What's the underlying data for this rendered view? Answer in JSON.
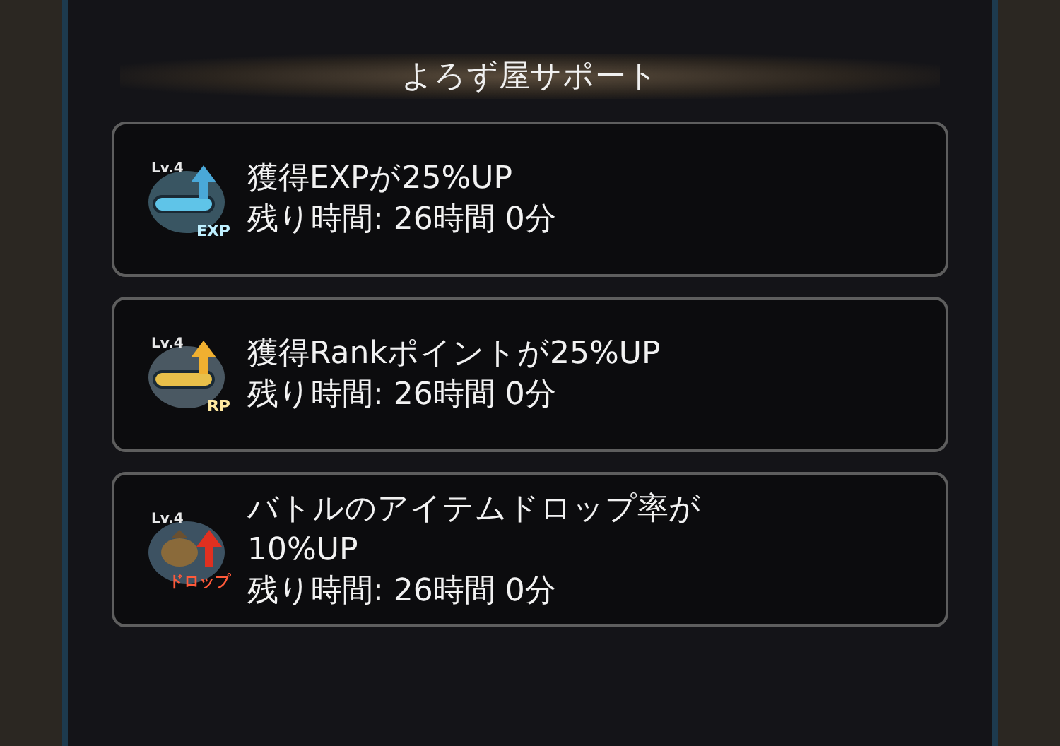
{
  "title": "よろず屋サポート",
  "supports": [
    {
      "kind": "exp",
      "level_label": "Lv.4",
      "badge": "EXP",
      "lines": [
        "獲得EXPが25%UP",
        "残り時間: 26時間 0分"
      ]
    },
    {
      "kind": "rp",
      "level_label": "Lv.4",
      "badge": "RP",
      "lines": [
        "獲得Rankポイントが25%UP",
        "残り時間: 26時間 0分"
      ]
    },
    {
      "kind": "drop",
      "level_label": "Lv.4",
      "badge": "ドロップ",
      "lines": [
        "バトルのアイテムドロップ率が",
        "10%UP",
        "残り時間: 26時間 0分"
      ]
    }
  ]
}
